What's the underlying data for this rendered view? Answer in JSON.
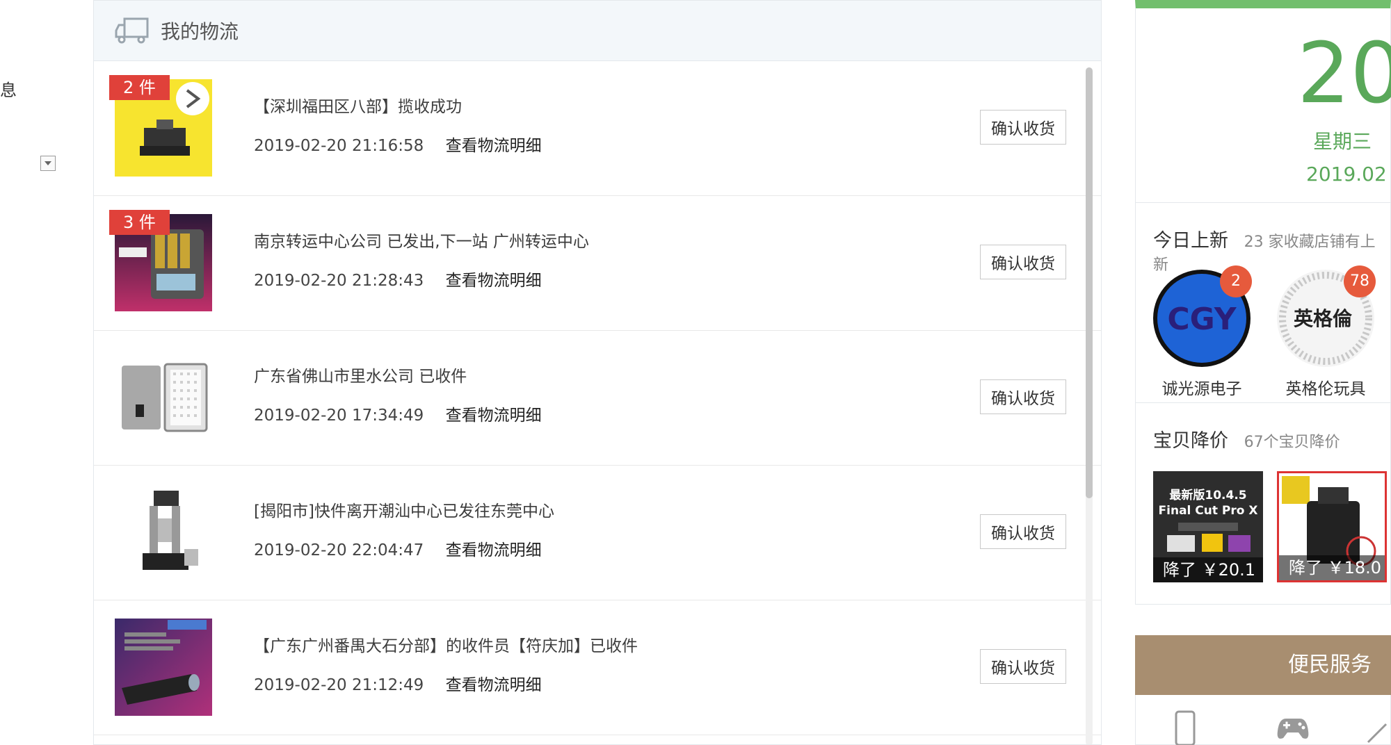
{
  "left_fragment": "息",
  "logistics": {
    "title": "我的物流",
    "detail_label": "查看物流明细",
    "confirm_label": "确认收货",
    "items": [
      {
        "badge": "2 件",
        "status": "【深圳福田区八部】揽收成功",
        "time": "2019-02-20 21:16:58"
      },
      {
        "badge": "3 件",
        "status": "南京转运中心公司 已发出,下一站 广州转运中心",
        "time": "2019-02-20 21:28:43"
      },
      {
        "badge": "",
        "status": "广东省佛山市里水公司 已收件",
        "time": "2019-02-20 17:34:49"
      },
      {
        "badge": "",
        "status": "[揭阳市]快件离开潮汕中心已发往东莞中心",
        "time": "2019-02-20 22:04:47"
      },
      {
        "badge": "",
        "status": "【广东广州番禺大石分部】的收件员【符庆加】已收件",
        "time": "2019-02-20 21:12:49"
      }
    ]
  },
  "calendar": {
    "day": "20",
    "weekday": "星期三",
    "date": "2019.02"
  },
  "new_today": {
    "title": "今日上新",
    "subtitle": "23 家收藏店铺有上新",
    "stores": [
      {
        "name": "诚光源电子",
        "count": "2",
        "logo_text": "CGY"
      },
      {
        "name": "英格伦玩具",
        "count": "78",
        "logo_text": "英格倫"
      }
    ]
  },
  "price_drop": {
    "title": "宝贝降价",
    "subtitle": "67个宝贝降价",
    "items": [
      {
        "label": "降了 ￥20.1",
        "art_line1": "最新版10.4.5",
        "art_line2": "Final Cut Pro X"
      },
      {
        "label": "降了 ￥18.0"
      }
    ]
  },
  "service": {
    "title": "便民服务"
  },
  "colors": {
    "accent_green": "#5aa85a",
    "badge_red": "#e0413a",
    "service_brown": "#a88e70"
  }
}
